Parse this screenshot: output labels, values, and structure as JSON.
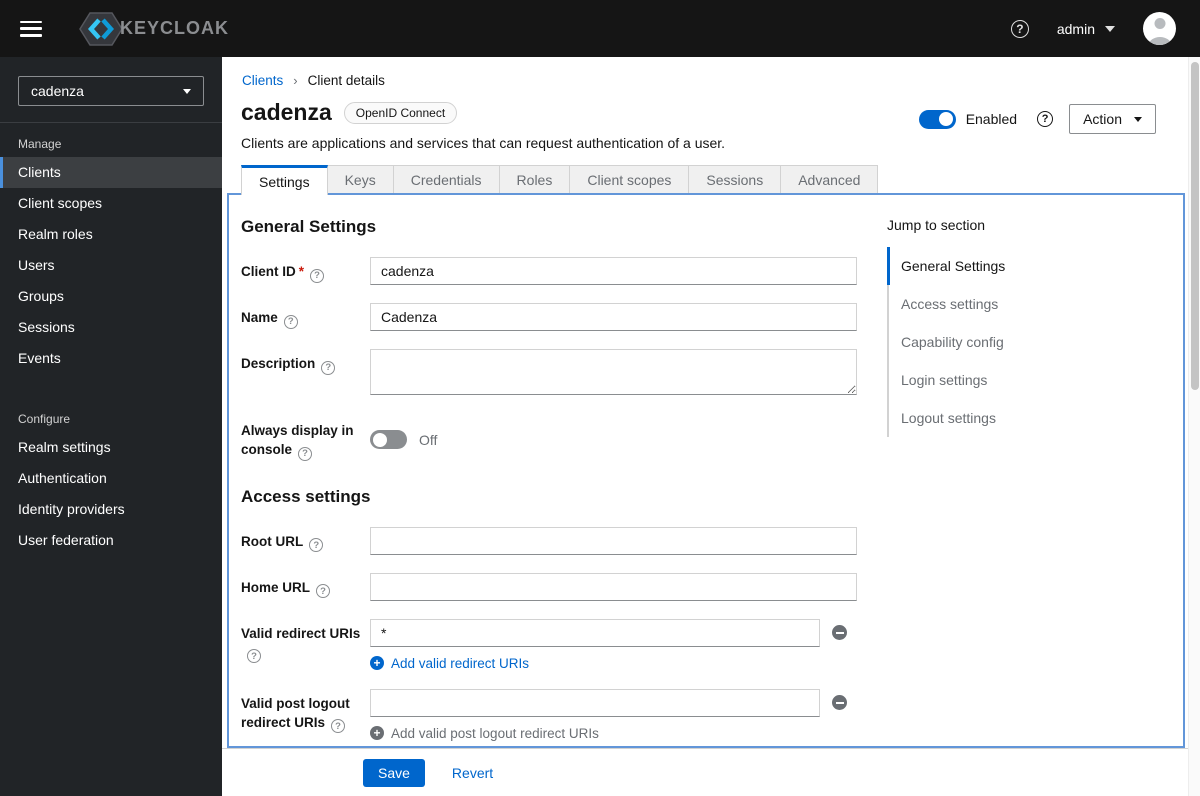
{
  "masthead": {
    "brand": "KEYCLOAK",
    "username": "admin"
  },
  "sidebar": {
    "realm": "cadenza",
    "groups": [
      {
        "label": "Manage",
        "items": [
          {
            "label": "Clients",
            "active": true
          },
          {
            "label": "Client scopes",
            "active": false
          },
          {
            "label": "Realm roles",
            "active": false
          },
          {
            "label": "Users",
            "active": false
          },
          {
            "label": "Groups",
            "active": false
          },
          {
            "label": "Sessions",
            "active": false
          },
          {
            "label": "Events",
            "active": false
          }
        ]
      },
      {
        "label": "Configure",
        "items": [
          {
            "label": "Realm settings",
            "active": false
          },
          {
            "label": "Authentication",
            "active": false
          },
          {
            "label": "Identity providers",
            "active": false
          },
          {
            "label": "User federation",
            "active": false
          }
        ]
      }
    ]
  },
  "breadcrumb": {
    "items": [
      "Clients",
      "Client details"
    ]
  },
  "header": {
    "title": "cadenza",
    "badge": "OpenID Connect",
    "subtitle": "Clients are applications and services that can request authentication of a user.",
    "enabled_label": "Enabled",
    "action_label": "Action"
  },
  "tabs": [
    {
      "label": "Settings",
      "active": true
    },
    {
      "label": "Keys",
      "active": false
    },
    {
      "label": "Credentials",
      "active": false
    },
    {
      "label": "Roles",
      "active": false
    },
    {
      "label": "Client scopes",
      "active": false
    },
    {
      "label": "Sessions",
      "active": false
    },
    {
      "label": "Advanced",
      "active": false
    }
  ],
  "form": {
    "general": {
      "heading": "General Settings",
      "client_id": {
        "label": "Client ID",
        "required": "*",
        "value": "cadenza"
      },
      "name": {
        "label": "Name",
        "value": "Cadenza"
      },
      "description": {
        "label": "Description",
        "value": ""
      },
      "always_display": {
        "label": "Always display in console",
        "state": "Off"
      }
    },
    "access": {
      "heading": "Access settings",
      "root_url": {
        "label": "Root URL",
        "value": ""
      },
      "home_url": {
        "label": "Home URL",
        "value": ""
      },
      "valid_redirect": {
        "label": "Valid redirect URIs",
        "value": "*",
        "add_label": "Add valid redirect URIs"
      },
      "post_logout": {
        "label": "Valid post logout redirect URIs",
        "value": "",
        "add_label": "Add valid post logout redirect URIs"
      }
    }
  },
  "jump": {
    "title": "Jump to section",
    "items": [
      {
        "label": "General Settings",
        "active": true
      },
      {
        "label": "Access settings",
        "active": false
      },
      {
        "label": "Capability config",
        "active": false
      },
      {
        "label": "Login settings",
        "active": false
      },
      {
        "label": "Logout settings",
        "active": false
      }
    ]
  },
  "footer": {
    "save": "Save",
    "revert": "Revert"
  },
  "colors": {
    "masthead_bg": "#151515",
    "sidebar_bg": "#212427",
    "nav_active_bg": "#3c3f42",
    "nav_accent": "#4a90dd",
    "link_blue": "#0066cc",
    "primary_blue": "#0066cc",
    "panel_border": "#6296d9",
    "tab_inactive_bg": "#f0f0f0",
    "muted_text": "#6a6e73",
    "border_gray": "#d2d2d2",
    "toggle_off": "#8a8d90",
    "required_red": "#c9190b",
    "logo_cyan": "#35c6f4",
    "logo_blue": "#0f9bd7"
  }
}
